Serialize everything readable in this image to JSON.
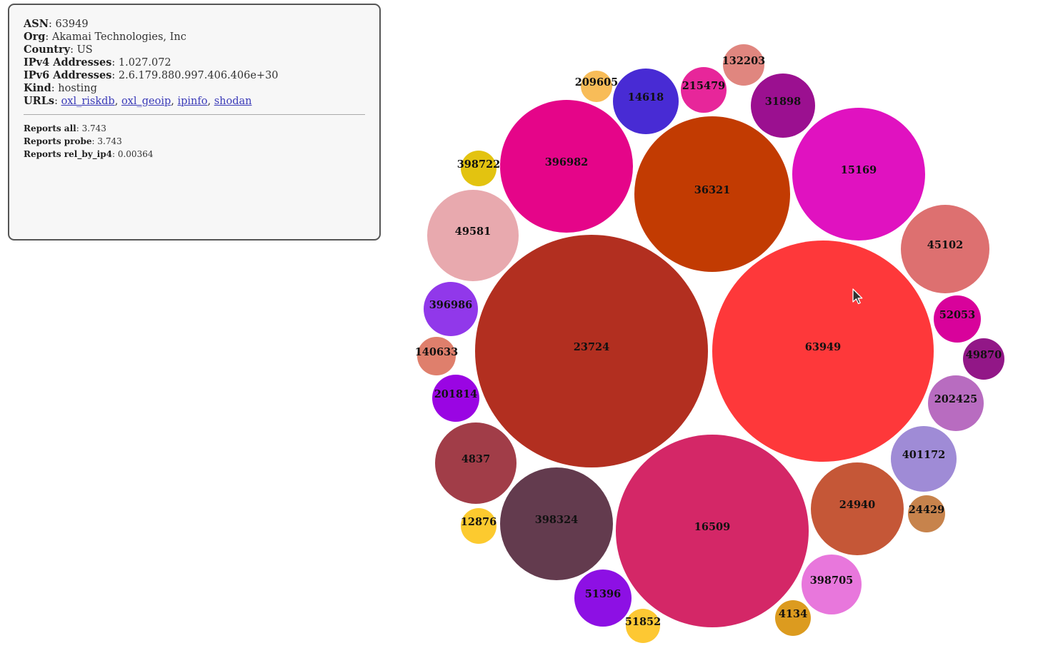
{
  "info": {
    "asn_label": "ASN",
    "asn_value": "63949",
    "org_label": "Org",
    "org_value": "Akamai Technologies, Inc",
    "country_label": "Country",
    "country_value": "US",
    "ipv4_label": "IPv4 Addresses",
    "ipv4_value": "1.027.072",
    "ipv6_label": "IPv6 Addresses",
    "ipv6_value": "2.6.179.880.997.406.406e+30",
    "kind_label": "Kind",
    "kind_value": "hosting",
    "urls_label": "URLs",
    "links": [
      "oxl_riskdb",
      "oxl_geoip",
      "ipinfo",
      "shodan"
    ]
  },
  "reports": {
    "all_label": "Reports all",
    "all_value": "3.743",
    "probe_label": "Reports probe",
    "probe_value": "3.743",
    "rel_label": "Reports rel_by_ip4",
    "rel_value": "0.00364"
  },
  "bubbles": [
    {
      "label": "63949",
      "color": "#fe383a"
    },
    {
      "label": "23724",
      "color": "#b22f20"
    },
    {
      "label": "16509",
      "color": "#d42767"
    },
    {
      "label": "36321",
      "color": "#c23b02"
    },
    {
      "label": "15169",
      "color": "#e012c0"
    },
    {
      "label": "396982",
      "color": "#e50589"
    },
    {
      "label": "398324",
      "color": "#633b4e"
    },
    {
      "label": "24940",
      "color": "#c55737"
    },
    {
      "label": "49581",
      "color": "#e8a9ae"
    },
    {
      "label": "45102",
      "color": "#dd7070"
    },
    {
      "label": "4837",
      "color": "#a13d48"
    },
    {
      "label": "14618",
      "color": "#482bd4"
    },
    {
      "label": "31898",
      "color": "#9b1090"
    },
    {
      "label": "401172",
      "color": "#9f8bd6"
    },
    {
      "label": "398705",
      "color": "#e877dc"
    },
    {
      "label": "51396",
      "color": "#8d10e4"
    },
    {
      "label": "202425",
      "color": "#b86cc0"
    },
    {
      "label": "396986",
      "color": "#9138ea"
    },
    {
      "label": "215479",
      "color": "#e7269a"
    },
    {
      "label": "201814",
      "color": "#9a05e3"
    },
    {
      "label": "52053",
      "color": "#d8029b"
    },
    {
      "label": "132203",
      "color": "#e0867f"
    },
    {
      "label": "49870",
      "color": "#921787"
    },
    {
      "label": "140633",
      "color": "#df7f6c"
    },
    {
      "label": "398722",
      "color": "#e3c310"
    },
    {
      "label": "12876",
      "color": "#fcca2f"
    },
    {
      "label": "24429",
      "color": "#c7834c"
    },
    {
      "label": "4134",
      "color": "#dc9b1f"
    },
    {
      "label": "51852",
      "color": "#fdc833"
    },
    {
      "label": "209605",
      "color": "#f8bc58"
    }
  ]
}
